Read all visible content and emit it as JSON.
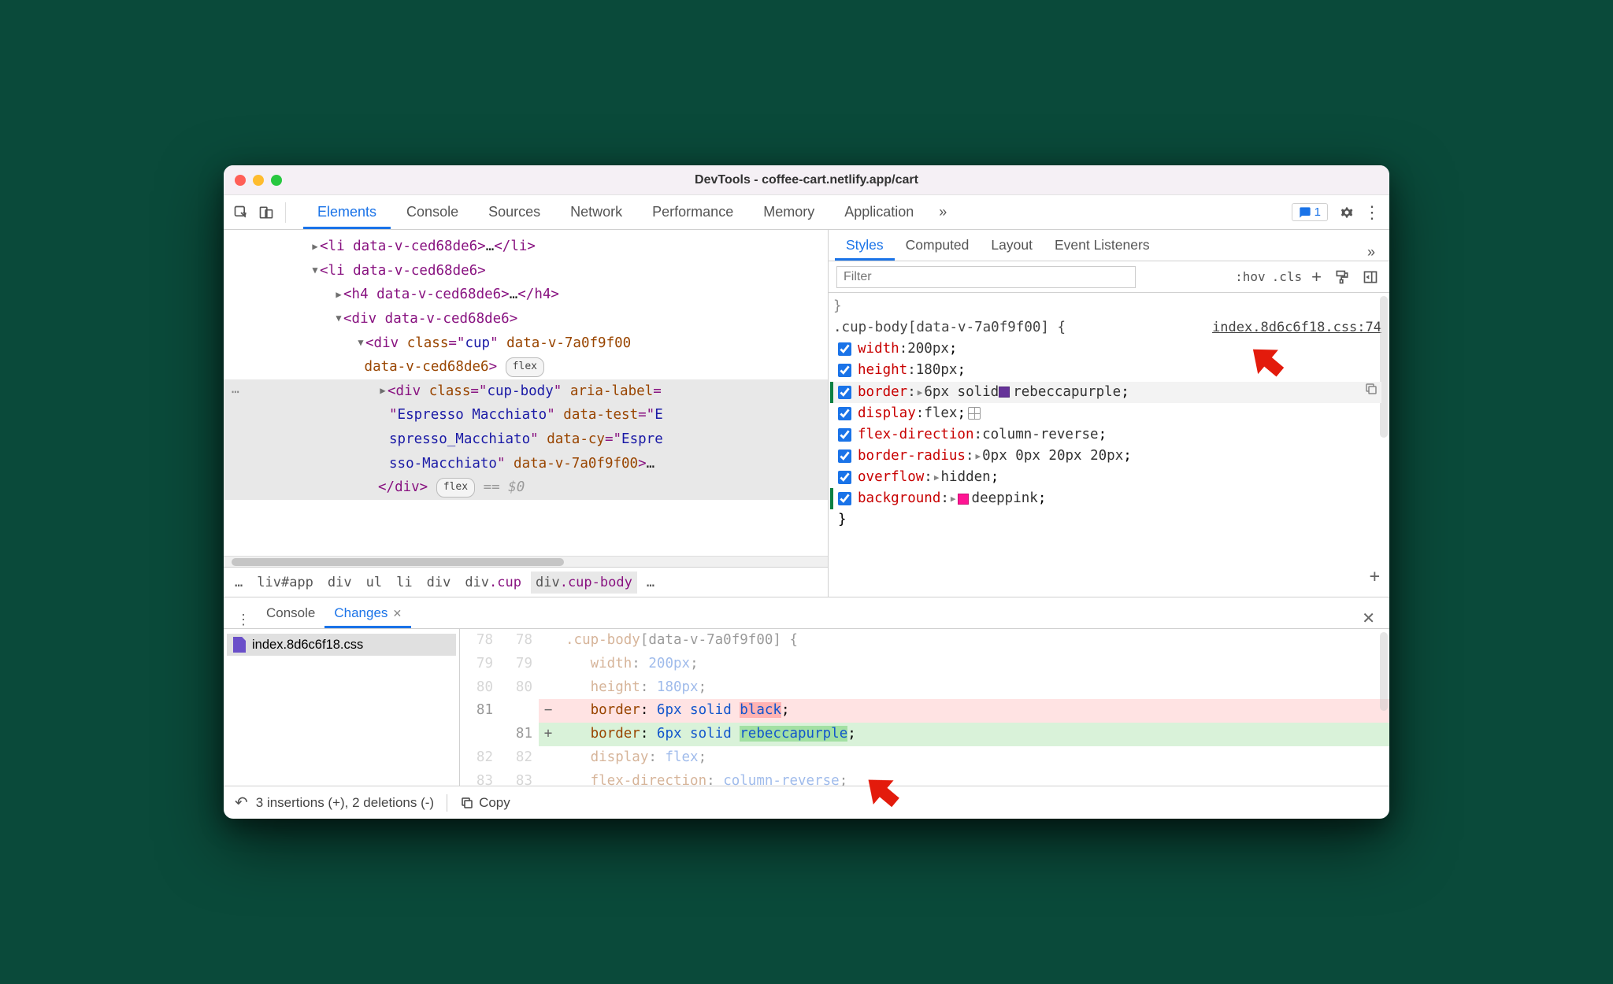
{
  "window": {
    "title": "DevTools - coffee-cart.netlify.app/cart"
  },
  "issue_count": "1",
  "main_tabs": [
    "Elements",
    "Console",
    "Sources",
    "Network",
    "Performance",
    "Memory",
    "Application"
  ],
  "main_tabs_active": 0,
  "dom": {
    "line1a": "<li data-v-ced68de6>",
    "line1b": "…",
    "line1c": "</li>",
    "line2": "<li data-v-ced68de6>",
    "line3a": "<h4 data-v-ced68de6>",
    "line3b": "…",
    "line3c": "</h4>",
    "line4": "<div data-v-ced68de6>",
    "line5a": "<div ",
    "line5b": "class",
    "line5c": "=\"",
    "line5d": "cup",
    "line5e": "\" ",
    "line5f": "data-v-7a0f9f00",
    "line6": " data-v-ced68de6",
    "line6b": ">",
    "flex_badge": "flex",
    "sel1": "<div ",
    "sel2": "class",
    "sel3": "=\"",
    "sel4": "cup-body",
    "sel5": "\" ",
    "sel6": "aria-label",
    "sel7": "=",
    "sel8": "\"",
    "sel9": "Espresso Macchiato",
    "sel10": "\" ",
    "sel11": "data-test",
    "sel12": "=\"",
    "sel13": "E",
    "sel14": "spresso_Macchiato",
    "sel15": "\" ",
    "sel16": "data-cy",
    "sel17": "=\"",
    "sel18": "Espre",
    "sel19": "sso-Macchiato",
    "sel20": "\" ",
    "sel21": "data-v-7a0f9f00",
    "sel22": ">",
    "sel23": "…",
    "close": "</div>",
    "eq": " == ",
    "d0": "$0"
  },
  "breadcrumbs": [
    "liv#app",
    "div",
    "ul",
    "li",
    "div",
    "div.cup",
    "div.cup-body"
  ],
  "bc_ellipsis": "…",
  "style_tabs": [
    "Styles",
    "Computed",
    "Layout",
    "Event Listeners"
  ],
  "style_tabs_active": 0,
  "filter_placeholder": "Filter",
  "hov": ":hov",
  "cls": ".cls",
  "rule": {
    "selector": ".cup-body[data-v-7a0f9f00] {",
    "source": "index.8d6c6f18.css:74",
    "props": [
      {
        "name": "width",
        "value": "200px",
        "edited": false,
        "expand": false
      },
      {
        "name": "height",
        "value": "180px",
        "edited": false,
        "expand": false
      },
      {
        "name": "border",
        "value": "6px solid ",
        "tail": "rebeccapurple",
        "swatch": "#663399",
        "edited": true,
        "expand": true,
        "hl": true,
        "copy": true
      },
      {
        "name": "display",
        "value": "flex",
        "grid": true,
        "edited": false,
        "expand": false
      },
      {
        "name": "flex-direction",
        "value": "column-reverse",
        "edited": false,
        "expand": false
      },
      {
        "name": "border-radius",
        "value": "0px 0px 20px 20px",
        "edited": false,
        "expand": true
      },
      {
        "name": "overflow",
        "value": "hidden",
        "edited": false,
        "expand": true
      },
      {
        "name": "background",
        "value": "",
        "tail": "deeppink",
        "swatch": "#ff1493",
        "edited": true,
        "expand": true
      }
    ],
    "close": "}"
  },
  "drawer_tabs": [
    "Console",
    "Changes"
  ],
  "drawer_tabs_active": 1,
  "changes_file": "index.8d6c6f18.css",
  "diff": {
    "r0": {
      "l": "78",
      "r": "78",
      "sel": ".cup-body",
      "selrest": "[data-v-7a0f9f00] {"
    },
    "r1": {
      "l": "79",
      "r": "79",
      "p": "width",
      "v": "200px"
    },
    "r2": {
      "l": "80",
      "r": "80",
      "p": "height",
      "v": "180px"
    },
    "r3": {
      "l": "81",
      "r": "",
      "p": "border",
      "pre": "6px solid ",
      "w": "black"
    },
    "r4": {
      "l": "",
      "r": "81",
      "p": "border",
      "pre": "6px solid ",
      "w": "rebeccapurple"
    },
    "r5": {
      "l": "82",
      "r": "82",
      "p": "display",
      "v": "flex"
    },
    "r6": {
      "l": "83",
      "r": "83",
      "p": "flex-direction",
      "v": "column-reverse"
    }
  },
  "status": {
    "summary": "3 insertions (+), 2 deletions (-)",
    "copy": "Copy"
  }
}
